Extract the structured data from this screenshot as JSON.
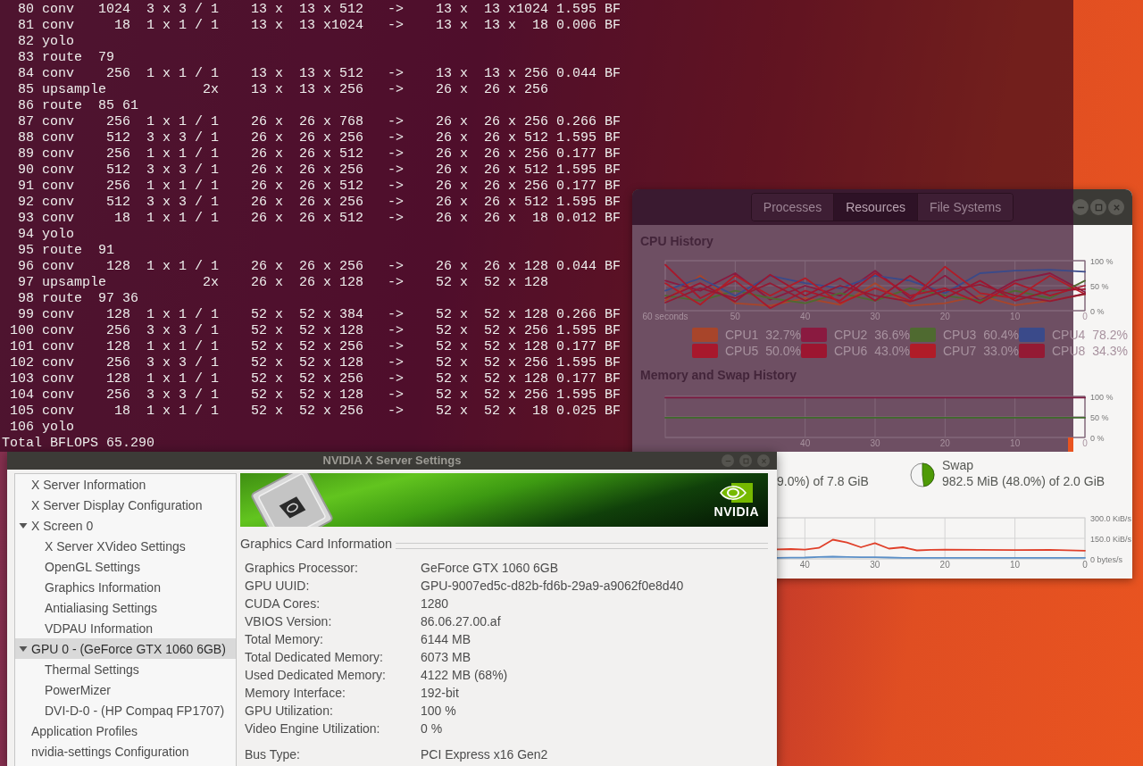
{
  "terminal": {
    "lines": [
      "  80 conv   1024  3 x 3 / 1    13 x  13 x 512   ->    13 x  13 x1024 1.595 BF",
      "  81 conv     18  1 x 1 / 1    13 x  13 x1024   ->    13 x  13 x  18 0.006 BF",
      "  82 yolo",
      "  83 route  79",
      "  84 conv    256  1 x 1 / 1    13 x  13 x 512   ->    13 x  13 x 256 0.044 BF",
      "  85 upsample            2x    13 x  13 x 256   ->    26 x  26 x 256",
      "  86 route  85 61",
      "  87 conv    256  1 x 1 / 1    26 x  26 x 768   ->    26 x  26 x 256 0.266 BF",
      "  88 conv    512  3 x 3 / 1    26 x  26 x 256   ->    26 x  26 x 512 1.595 BF",
      "  89 conv    256  1 x 1 / 1    26 x  26 x 512   ->    26 x  26 x 256 0.177 BF",
      "  90 conv    512  3 x 3 / 1    26 x  26 x 256   ->    26 x  26 x 512 1.595 BF",
      "  91 conv    256  1 x 1 / 1    26 x  26 x 512   ->    26 x  26 x 256 0.177 BF",
      "  92 conv    512  3 x 3 / 1    26 x  26 x 256   ->    26 x  26 x 512 1.595 BF",
      "  93 conv     18  1 x 1 / 1    26 x  26 x 512   ->    26 x  26 x  18 0.012 BF",
      "  94 yolo",
      "  95 route  91",
      "  96 conv    128  1 x 1 / 1    26 x  26 x 256   ->    26 x  26 x 128 0.044 BF",
      "  97 upsample            2x    26 x  26 x 128   ->    52 x  52 x 128",
      "  98 route  97 36",
      "  99 conv    128  1 x 1 / 1    52 x  52 x 384   ->    52 x  52 x 128 0.266 BF",
      " 100 conv    256  3 x 3 / 1    52 x  52 x 128   ->    52 x  52 x 256 1.595 BF",
      " 101 conv    128  1 x 1 / 1    52 x  52 x 256   ->    52 x  52 x 128 0.177 BF",
      " 102 conv    256  3 x 3 / 1    52 x  52 x 128   ->    52 x  52 x 256 1.595 BF",
      " 103 conv    128  1 x 1 / 1    52 x  52 x 256   ->    52 x  52 x 128 0.177 BF",
      " 104 conv    256  3 x 3 / 1    52 x  52 x 128   ->    52 x  52 x 256 1.595 BF",
      " 105 conv     18  1 x 1 / 1    52 x  52 x 256   ->    52 x  52 x  18 0.025 BF",
      " 106 yolo",
      "Total BFLOPS 65.290"
    ]
  },
  "system_monitor": {
    "tabs": [
      {
        "label": "Processes",
        "selected": false
      },
      {
        "label": "Resources",
        "selected": true
      },
      {
        "label": "File Systems",
        "selected": false
      }
    ],
    "cpu_history": {
      "title": "CPU History",
      "legend": [
        {
          "label": "CPU1",
          "value": "32.7%",
          "color": "#a8452a"
        },
        {
          "label": "CPU2",
          "value": "36.6%",
          "color": "#8a1a40"
        },
        {
          "label": "CPU3",
          "value": "60.4%",
          "color": "#4f6a30"
        },
        {
          "label": "CPU4",
          "value": "78.2%",
          "color": "#3a4a8a"
        },
        {
          "label": "CPU5",
          "value": "50.0%",
          "color": "#a8182c"
        },
        {
          "label": "CPU6",
          "value": "43.0%",
          "color": "#9c1630"
        },
        {
          "label": "CPU7",
          "value": "33.0%",
          "color": "#b01c28"
        },
        {
          "label": "CPU8",
          "value": "34.3%",
          "color": "#941a34"
        }
      ],
      "chart_data": {
        "type": "line",
        "x": [
          60,
          55,
          50,
          45,
          40,
          35,
          30,
          25,
          20,
          15,
          10,
          5,
          0
        ],
        "xlim": [
          60,
          0
        ],
        "ylim": [
          0,
          100
        ],
        "grid": true,
        "xticks": [
          {
            "value": 60,
            "label": "60 seconds"
          },
          50,
          40,
          30,
          20,
          10,
          0
        ],
        "yticks": [
          {
            "value": 100,
            "label": "100 %"
          },
          {
            "value": 50,
            "label": "50 %"
          },
          {
            "value": 0,
            "label": "0 %"
          }
        ],
        "series": [
          {
            "color": "#a8452a",
            "values": [
              20,
              70,
              15,
              10,
              25,
              12,
              55,
              10,
              15,
              30,
              11,
              20,
              33
            ]
          },
          {
            "color": "#8a1a40",
            "values": [
              60,
              40,
              75,
              22,
              50,
              30,
              80,
              25,
              70,
              20,
              60,
              75,
              37
            ]
          },
          {
            "color": "#4f6a30",
            "values": [
              30,
              20,
              40,
              25,
              15,
              35,
              20,
              45,
              30,
              20,
              40,
              25,
              60
            ]
          },
          {
            "color": "#3a4a8a",
            "values": [
              40,
              65,
              30,
              70,
              55,
              45,
              70,
              60,
              35,
              75,
              80,
              82,
              78
            ]
          },
          {
            "color": "#a8182c",
            "values": [
              92,
              25,
              60,
              5,
              40,
              20,
              75,
              30,
              45,
              15,
              55,
              30,
              50
            ]
          },
          {
            "color": "#9c1630",
            "values": [
              25,
              55,
              18,
              72,
              30,
              65,
              20,
              70,
              25,
              60,
              20,
              40,
              43
            ]
          },
          {
            "color": "#b01c28",
            "values": [
              55,
              12,
              70,
              30,
              65,
              15,
              45,
              20,
              88,
              35,
              25,
              70,
              33
            ]
          },
          {
            "color": "#941a34",
            "values": [
              16,
              45,
              25,
              55,
              20,
              50,
              30,
              18,
              40,
              52,
              30,
              19,
              34
            ]
          }
        ]
      }
    },
    "memory_swap_history": {
      "title": "Memory and Swap History",
      "chart_data": {
        "type": "line",
        "x": [
          60,
          0
        ],
        "xlim": [
          60,
          0
        ],
        "ylim": [
          0,
          100
        ],
        "grid": true,
        "xticks": [
          40,
          30,
          20,
          10,
          0
        ],
        "yticks": [
          {
            "value": 100,
            "label": "100 %"
          },
          {
            "value": 50,
            "label": "50 %"
          },
          {
            "value": 0,
            "label": "0 %"
          }
        ],
        "series": [
          {
            "color": "#7a1a40",
            "values": [
              97,
              97
            ]
          },
          {
            "color": "#3f6a2c",
            "values": [
              48,
              48
            ]
          }
        ]
      },
      "memory": {
        "text": "9.0%) of 7.8 GiB"
      },
      "swap": {
        "label": "Swap",
        "text": "982.5 MiB (48.0%) of 2.0 GiB",
        "level": 0.48
      }
    },
    "network_history": {
      "chart_data": {
        "type": "line",
        "x": [
          44,
          42,
          40,
          38,
          36,
          34,
          32,
          30,
          28,
          26,
          24,
          22,
          20,
          15,
          10,
          5,
          0
        ],
        "xlim": [
          44,
          0
        ],
        "ylim": [
          0,
          300
        ],
        "grid": true,
        "xticks": [
          40,
          30,
          20,
          10,
          0
        ],
        "yticks": [
          {
            "value": 300,
            "label": "300.0 KiB/s"
          },
          {
            "value": 150,
            "label": "150.0 KiB/s"
          },
          {
            "value": 0,
            "label": "0 bytes/s"
          }
        ],
        "series": [
          {
            "color": "#e0402a",
            "values": [
              70,
              72,
              68,
              80,
              140,
              120,
              85,
              115,
              75,
              85,
              62,
              66,
              68,
              66,
              64,
              66,
              60
            ]
          },
          {
            "color": "#5b8fc7",
            "values": [
              8,
              9,
              10,
              14,
              16,
              14,
              12,
              12,
              10,
              8,
              8,
              8,
              8,
              8,
              8,
              8,
              8
            ]
          }
        ]
      }
    }
  },
  "nvidia_settings": {
    "window": {
      "title": "NVIDIA X Server Settings"
    },
    "tree": [
      {
        "label": "X Server Information",
        "selected": false
      },
      {
        "label": "X Server Display Configuration",
        "selected": false
      },
      {
        "label": "X Screen 0",
        "selected": false,
        "expanded": true,
        "children": [
          {
            "label": "X Server XVideo Settings",
            "selected": false
          },
          {
            "label": "OpenGL Settings",
            "selected": false
          },
          {
            "label": "Graphics Information",
            "selected": false
          },
          {
            "label": "Antialiasing Settings",
            "selected": false
          },
          {
            "label": "VDPAU Information",
            "selected": false
          }
        ]
      },
      {
        "label": "GPU 0 - (GeForce GTX 1060 6GB)",
        "selected": true,
        "expanded": true,
        "children": [
          {
            "label": "Thermal Settings",
            "selected": false
          },
          {
            "label": "PowerMizer",
            "selected": false
          },
          {
            "label": "DVI-D-0 - (HP Compaq FP1707)",
            "selected": false
          }
        ]
      },
      {
        "label": "Application Profiles",
        "selected": false
      },
      {
        "label": "nvidia-settings Configuration",
        "selected": false
      }
    ],
    "banner": {
      "logo_text": "NVIDIA"
    },
    "section_title": "Graphics Card Information",
    "info": [
      {
        "label": "Graphics Processor:",
        "value": "GeForce GTX 1060 6GB"
      },
      {
        "label": "GPU UUID:",
        "value": "GPU-9007ed5c-d82b-fd6b-29a9-a9062f0e8d40"
      },
      {
        "label": "CUDA Cores:",
        "value": "1280"
      },
      {
        "label": "VBIOS Version:",
        "value": "86.06.27.00.af"
      },
      {
        "label": "Total Memory:",
        "value": "6144 MB"
      },
      {
        "label": "Total Dedicated Memory:",
        "value": "6073 MB"
      },
      {
        "label": "Used Dedicated Memory:",
        "value": "4122 MB (68%)"
      },
      {
        "label": "Memory Interface:",
        "value": "192-bit"
      },
      {
        "label": "GPU Utilization:",
        "value": "100 %"
      },
      {
        "label": "Video Engine Utilization:",
        "value": "0 %"
      }
    ],
    "extra_info": [
      {
        "label": "Bus Type:",
        "value": "PCI Express x16 Gen2"
      }
    ]
  }
}
